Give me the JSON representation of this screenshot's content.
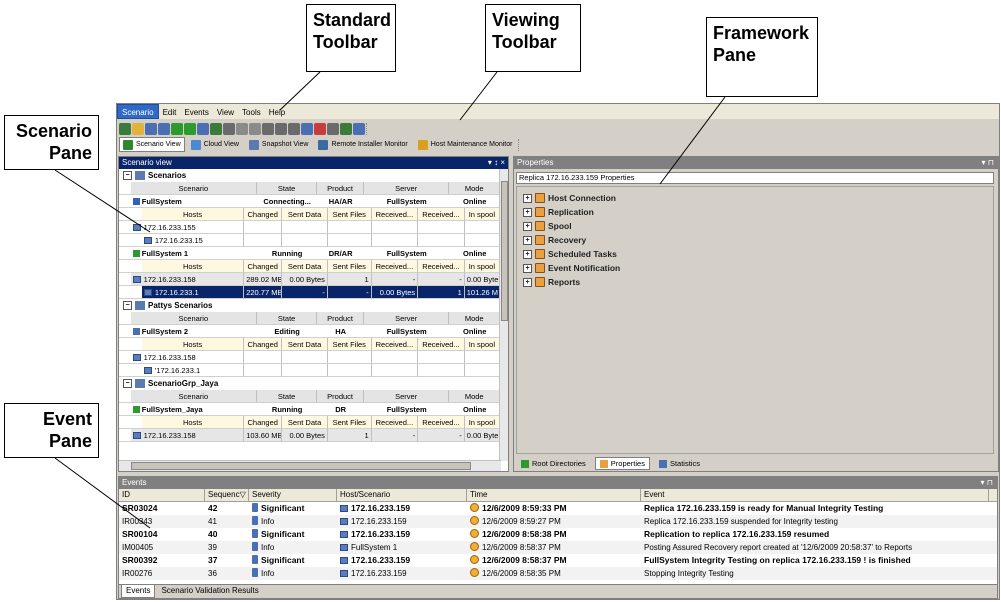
{
  "callouts": {
    "standard_toolbar": [
      "Standard",
      "Toolbar"
    ],
    "viewing_toolbar": [
      "Viewing",
      "Toolbar"
    ],
    "framework_pane": [
      "Framework",
      "Pane"
    ],
    "scenario_pane": [
      "Scenario",
      "Pane"
    ],
    "event_pane": [
      "Event",
      "Pane"
    ]
  },
  "menu": [
    "Scenario",
    "Edit",
    "Events",
    "View",
    "Tools",
    "Help"
  ],
  "viewing_toolbar": [
    "Scenario View",
    "Cloud View",
    "Snapshot View",
    "Remote Installer Monitor",
    "Host Maintenance Monitor"
  ],
  "scenario_pane": {
    "title": "Scenario view",
    "controls": "▾ ↕ ×",
    "groups": [
      {
        "name": "Scenarios",
        "columns": [
          "Scenario",
          "State",
          "Product",
          "Server",
          "Mode"
        ],
        "scenarios": [
          {
            "name": "FullSystem",
            "state": "Connecting...",
            "product": "HA/AR",
            "server": "FullSystem",
            "mode": "Online",
            "host_columns": [
              "Hosts",
              "Changed",
              "Sent Data",
              "Sent Files",
              "Received...",
              "Received...",
              "In spool"
            ],
            "hosts": [
              {
                "name": "172.16.233.155",
                "values": [
                  "",
                  "",
                  "",
                  "",
                  "",
                  ""
                ]
              },
              {
                "name": "172.16.233.15",
                "values": [
                  "",
                  "",
                  "",
                  "",
                  "",
                  ""
                ]
              }
            ]
          },
          {
            "name": "FullSystem 1",
            "state": "Running",
            "product": "DR/AR",
            "server": "FullSystem",
            "mode": "Online",
            "host_columns": [
              "Hosts",
              "Changed",
              "Sent Data",
              "Sent Files",
              "Received...",
              "Received...",
              "In spool"
            ],
            "hosts": [
              {
                "name": "172.16.233.158",
                "values": [
                  "289.02 MB",
                  "0.00 Bytes",
                  "1",
                  "-",
                  "-",
                  "0.00 Byte"
                ]
              },
              {
                "name": "172.16.233.1",
                "values": [
                  "220.77 MB",
                  "-",
                  "-",
                  "0.00 Bytes",
                  "1",
                  "101.26 M"
                ]
              }
            ]
          }
        ]
      },
      {
        "name": "Pattys Scenarios",
        "columns": [
          "Scenario",
          "State",
          "Product",
          "Server",
          "Mode"
        ],
        "scenarios": [
          {
            "name": "FullSystem 2",
            "state": "Editing",
            "product": "HA",
            "server": "FullSystem",
            "mode": "Online",
            "host_columns": [
              "Hosts",
              "Changed",
              "Sent Data",
              "Sent Files",
              "Received...",
              "Received...",
              "In spool"
            ],
            "hosts": [
              {
                "name": "172.16.233.158",
                "values": [
                  "",
                  "",
                  "",
                  "",
                  "",
                  ""
                ]
              },
              {
                "name": "'172.16.233.1",
                "values": [
                  "",
                  "",
                  "",
                  "",
                  "",
                  ""
                ]
              }
            ]
          }
        ]
      },
      {
        "name": "ScenarioGrp_Jaya",
        "columns": [
          "Scenario",
          "State",
          "Product",
          "Server",
          "Mode"
        ],
        "scenarios": [
          {
            "name": "FullSystem_Jaya",
            "state": "Running",
            "product": "DR",
            "server": "FullSystem",
            "mode": "Online",
            "host_columns": [
              "Hosts",
              "Changed",
              "Sent Data",
              "Sent Files",
              "Received...",
              "Received...",
              "In spool"
            ],
            "hosts": [
              {
                "name": "172.16.233.158",
                "values": [
                  "103.60 MB",
                  "0.00 Bytes",
                  "1",
                  "-",
                  "-",
                  "0.00 Byte"
                ]
              }
            ]
          }
        ]
      }
    ]
  },
  "framework_pane": {
    "title": "Properties",
    "address": "Replica 172.16.233.159    Properties",
    "items": [
      "Host Connection",
      "Replication",
      "Spool",
      "Recovery",
      "Scheduled Tasks",
      "Event Notification",
      "Reports"
    ],
    "tabs": [
      "Root Directories",
      "Properties",
      "Statistics"
    ],
    "active_tab": 1
  },
  "event_pane": {
    "title": "Events",
    "columns": [
      "ID",
      "Sequenc▽",
      "Severity",
      "Host/Scenario",
      "Time",
      "Event"
    ],
    "rows": [
      {
        "id": "SR03024",
        "seq": "42",
        "severity": "Significant",
        "host": "172.16.233.159",
        "time": "12/6/2009 8:59:33 PM",
        "event": "Replica  172.16.233.159  is ready for Manual Integrity Testing",
        "significant": true
      },
      {
        "id": "IR00343",
        "seq": "41",
        "severity": "Info",
        "host": "172.16.233.159",
        "time": "12/6/2009 8:59:27 PM",
        "event": "Replica  172.16.233.159  suspended for Integrity testing",
        "significant": false
      },
      {
        "id": "SR00104",
        "seq": "40",
        "severity": "Significant",
        "host": "172.16.233.159",
        "time": "12/6/2009 8:58:38 PM",
        "event": "Replication to replica  172.16.233.159  resumed",
        "significant": true
      },
      {
        "id": "IM00405",
        "seq": "39",
        "severity": "Info",
        "host": "FullSystem 1",
        "time": "12/6/2009 8:58:37 PM",
        "event": "Posting Assured Recovery report created at '12/6/2009 20:58:37' to Reports",
        "significant": false
      },
      {
        "id": "SR00392",
        "seq": "37",
        "severity": "Significant",
        "host": "172.16.233.159",
        "time": "12/6/2009 8:58:37 PM",
        "event": "FullSystem Integrity Testing on replica  172.16.233.159 ! is finished",
        "significant": true
      },
      {
        "id": "IR00276",
        "seq": "36",
        "severity": "Info",
        "host": "172.16.233.159",
        "time": "12/6/2009 8:58:35 PM",
        "event": "Stopping  Integrity Testing",
        "significant": false
      }
    ],
    "tabs": [
      "Events",
      "Scenario Validation Results"
    ]
  }
}
